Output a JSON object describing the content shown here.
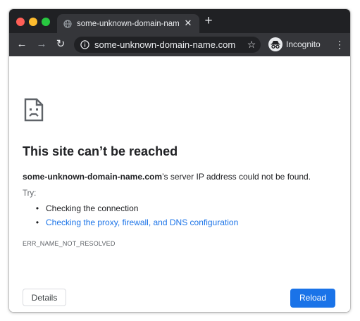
{
  "browser": {
    "tab": {
      "title": "some-unknown-domain-name",
      "close_glyph": "✕",
      "icon": "globe-icon"
    },
    "new_tab_glyph": "+",
    "toolbar": {
      "back_glyph": "←",
      "forward_glyph": "→",
      "reload_glyph": "↻",
      "url": "some-unknown-domain-name.com",
      "star_glyph": "☆",
      "incognito_label": "Incognito",
      "menu_glyph": "⋮"
    }
  },
  "error_page": {
    "icon": "sad-page-icon",
    "heading": "This site can’t be reached",
    "detail_domain": "some-unknown-domain-name.com",
    "detail_rest": "’s server IP address could not be found.",
    "try_label": "Try:",
    "suggestions": [
      {
        "text": "Checking the connection",
        "is_link": false
      },
      {
        "text": "Checking the proxy, firewall, and DNS configuration",
        "is_link": true
      }
    ],
    "error_code": "ERR_NAME_NOT_RESOLVED",
    "details_button": "Details",
    "reload_button": "Reload"
  },
  "colors": {
    "tabstrip_bg": "#202124",
    "toolbar_bg": "#35363a",
    "link": "#1a73e8",
    "primary_button": "#1a73e8",
    "text": "#202124",
    "secondary_text": "#5f6368"
  }
}
